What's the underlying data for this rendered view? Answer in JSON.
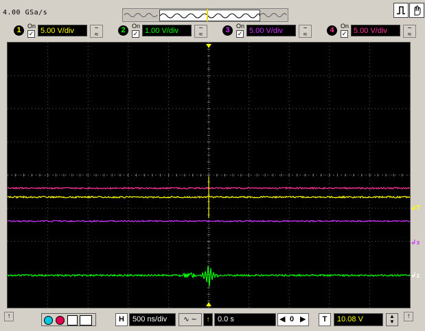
{
  "header": {
    "sample_rate": "4.00 GSa/s"
  },
  "channels": [
    {
      "num": "1",
      "on_label": "On",
      "scale": "5.00 V/div",
      "color": "#ffff00"
    },
    {
      "num": "2",
      "on_label": "On",
      "scale": "1.00 V/div",
      "color": "#00ff00"
    },
    {
      "num": "3",
      "on_label": "On",
      "scale": "5.00 V/div",
      "color": "#cc33ff"
    },
    {
      "num": "4",
      "on_label": "On",
      "scale": "5.00 V/div",
      "color": "#ff3399"
    }
  ],
  "markers": {
    "trigger_label": "T",
    "ch2_label": "2",
    "ch3_label": "3",
    "ch1_label": "1"
  },
  "bottom": {
    "h_label": "H",
    "timebase": "500 ns/div",
    "delay": "0.0 s",
    "t_label": "T",
    "trigger_level": "10.08 V",
    "nav_center": "0"
  },
  "icons": {
    "run_icon": "circle-cyan",
    "stop_icon": "circle-red"
  }
}
